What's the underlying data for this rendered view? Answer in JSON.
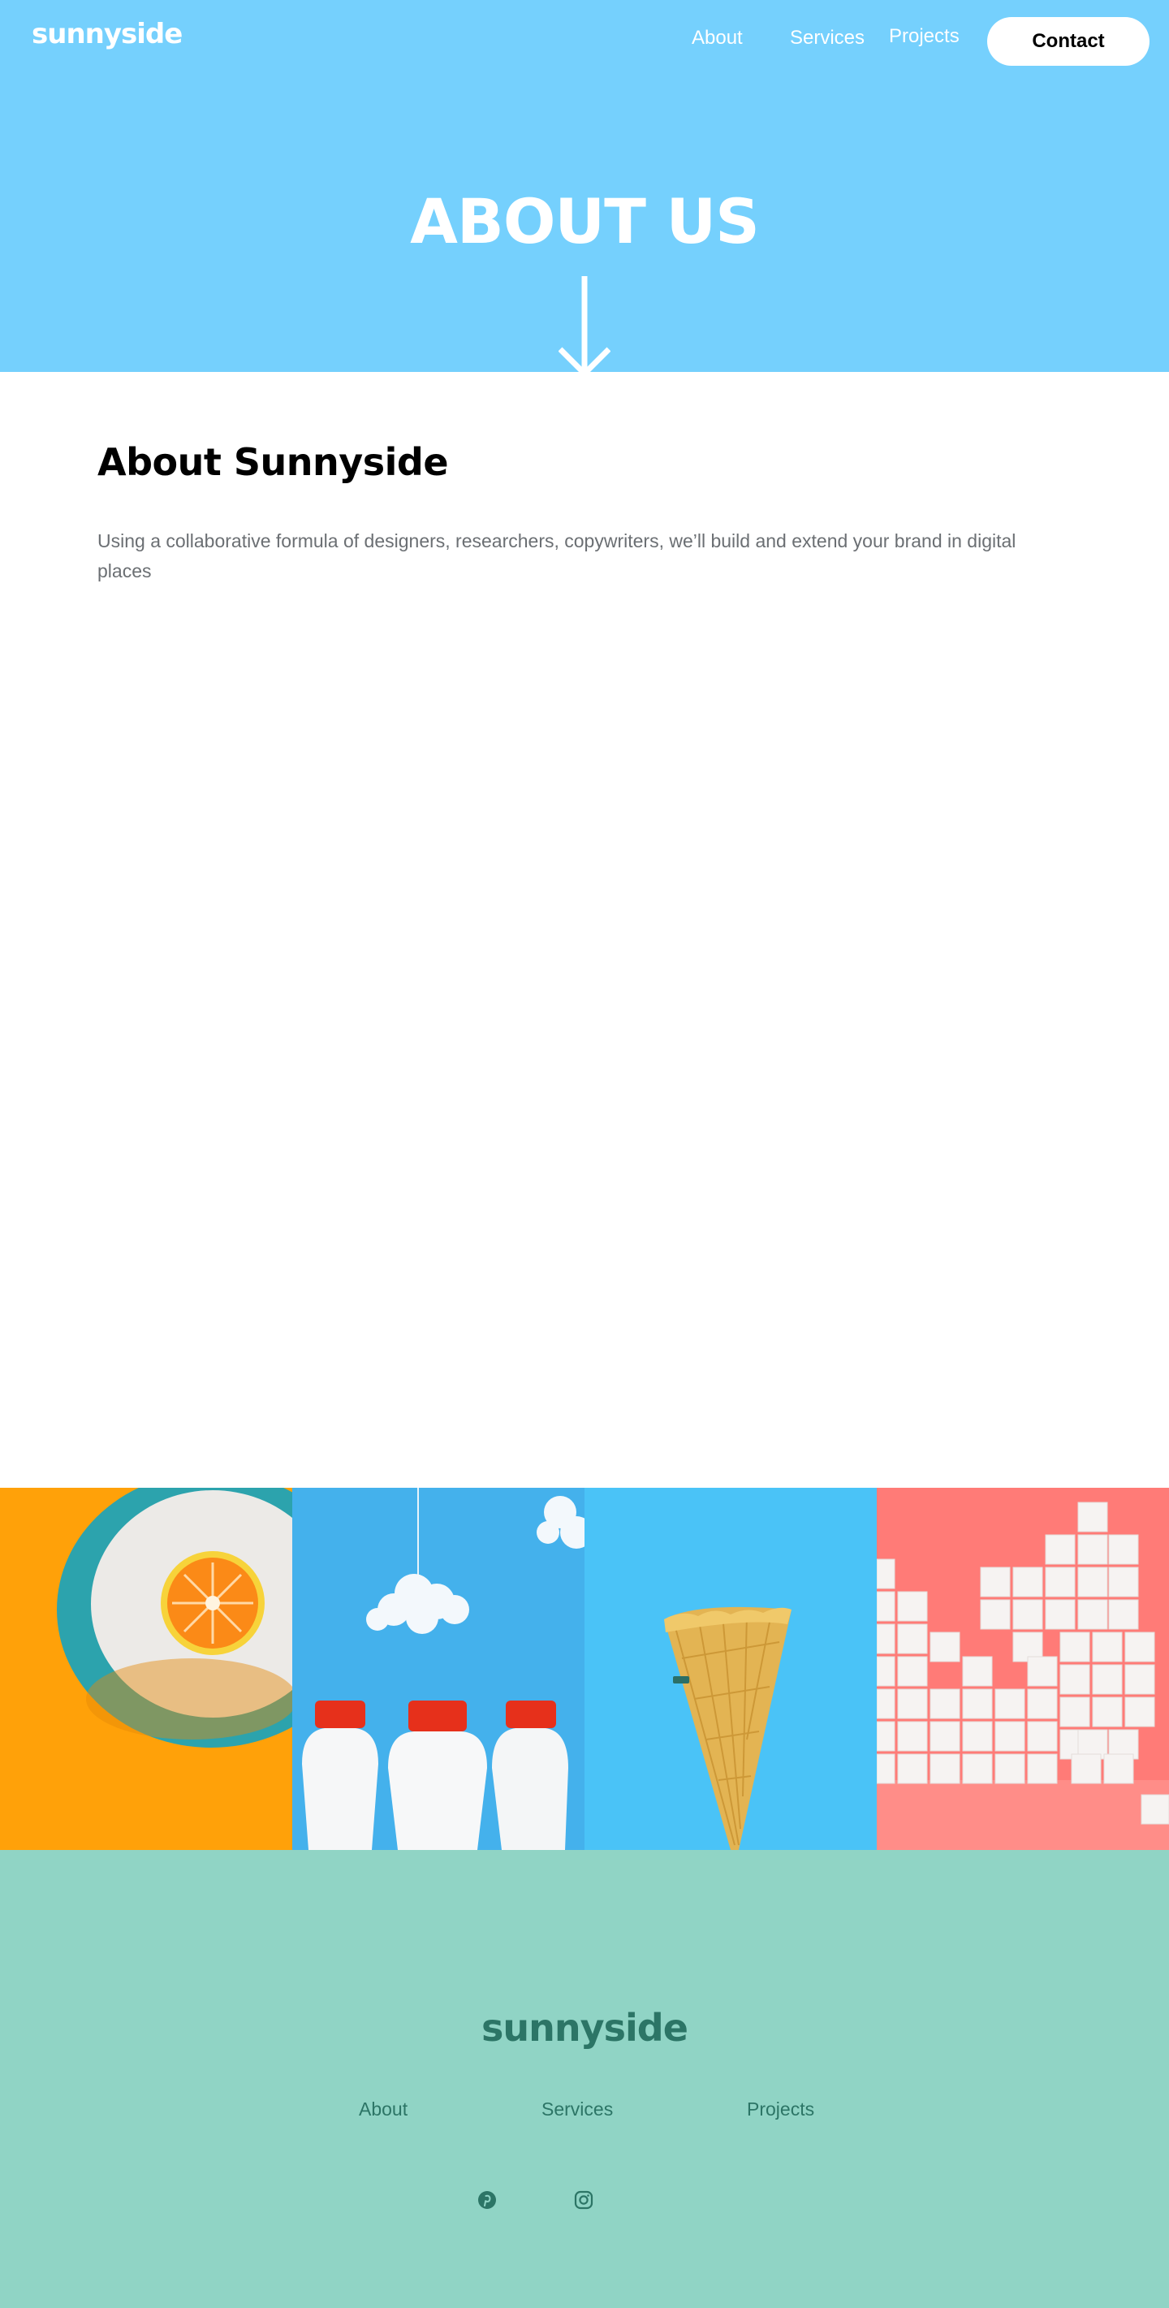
{
  "header": {
    "logo": "sunnyside",
    "nav": {
      "about": "About",
      "services": "Services",
      "projects": "Projects"
    },
    "contact_label": "Contact",
    "title": "ABOUT US"
  },
  "about": {
    "title": "About Sunnyside",
    "text": "Using a collaborative formula of designers, researchers, copywriters, we’ll build and extend your brand in digital places"
  },
  "gallery": {
    "images": [
      "orange-slice-on-plate",
      "milk-bottles-with-clouds",
      "ice-cream-cone",
      "sugar-cubes"
    ]
  },
  "footer": {
    "logo": "sunnyside",
    "nav": {
      "about": "About",
      "services": "Services",
      "projects": "Projects"
    },
    "social": [
      "pinterest-icon",
      "instagram-icon"
    ]
  },
  "colors": {
    "hero_bg": "#75d0fd",
    "footer_bg": "#90d4c5",
    "footer_text": "#2c7566",
    "body_text": "#6b6f73"
  }
}
